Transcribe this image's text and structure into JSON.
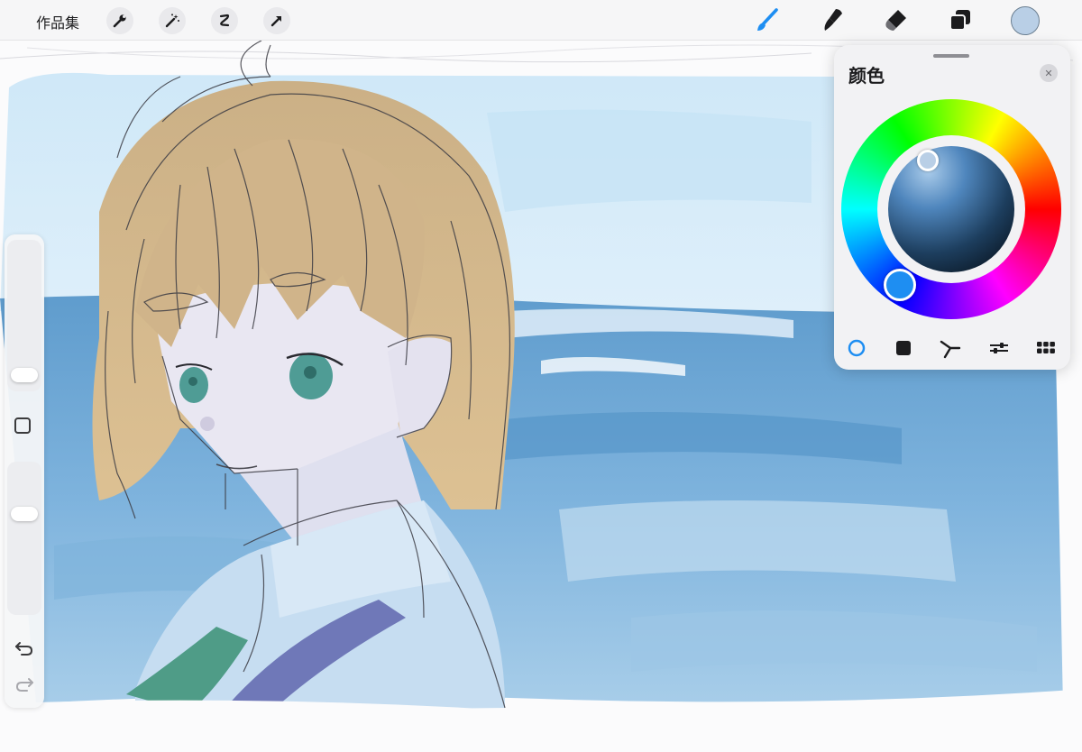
{
  "toolbar": {
    "gallery_label": "作品集",
    "left_tools": [
      "wrench-icon",
      "magic-wand-icon",
      "selection-icon",
      "transform-arrow-icon"
    ],
    "right_tools": [
      "brush-icon",
      "smudge-icon",
      "eraser-icon",
      "layers-icon"
    ],
    "active_tool": "brush-icon",
    "current_color": "#b9cfe6"
  },
  "color_panel": {
    "title": "颜色",
    "modes": [
      "disc-mode-icon",
      "classic-mode-icon",
      "harmony-mode-icon",
      "value-mode-icon",
      "palette-mode-icon"
    ],
    "active_mode": "disc-mode-icon"
  },
  "colors": {
    "accent": "#1e8ef2",
    "sky": "#d2eaf8",
    "sea": "#6aa7d6",
    "hair": "#d8ba88",
    "skin": "#e9e7f2",
    "eyes": "#4f9c95"
  }
}
